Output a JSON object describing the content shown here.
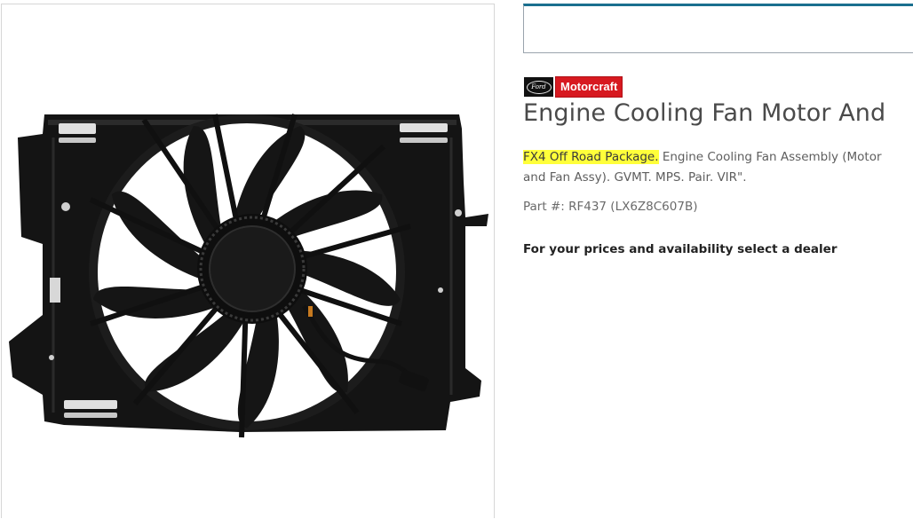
{
  "brand": {
    "ford_logo_text": "Ford",
    "motorcraft_label": "Motorcraft",
    "colors": {
      "motorcraft_red": "#d71920",
      "ford_black": "#111111",
      "accent": "#1a6f8f",
      "highlight": "#ffff3a"
    }
  },
  "product": {
    "title": "Engine Cooling Fan Motor And",
    "description_highlight": "FX4 Off Road Package.",
    "description_rest": " Engine Cooling Fan Assembly (Motor and Fan Assy). GVMT. MPS. Pair. VIR\".",
    "part_number": "Part #: RF437 (LX6Z8C607B)",
    "image_icon": "cooling-fan-assembly-photo"
  },
  "dealer": {
    "prompt": "For your prices and availability select a dealer"
  }
}
